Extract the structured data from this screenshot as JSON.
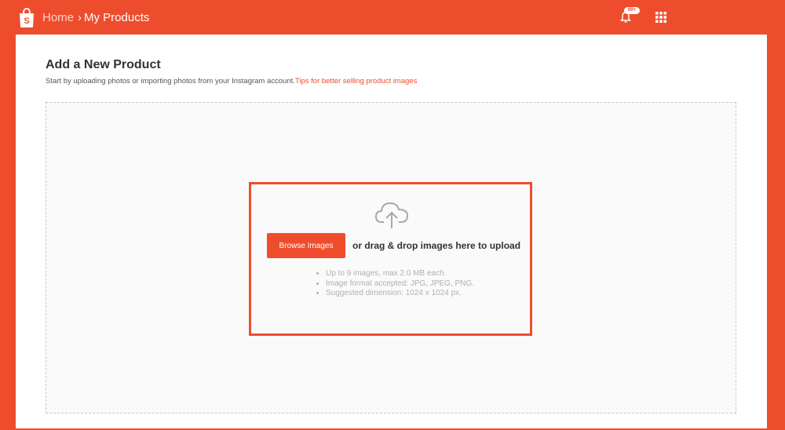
{
  "header": {
    "breadcrumb": {
      "home": "Home",
      "separator": "›",
      "current": "My Products"
    },
    "notification_badge": "99+",
    "icons": {
      "logo": "shopee-bag-icon",
      "bell": "bell-icon",
      "apps": "grid-apps-icon"
    }
  },
  "page": {
    "title": "Add a New Product",
    "subtitle": "Start by uploading photos or importing photos from your Instagram account.",
    "tips_link": "Tips for better selling product images"
  },
  "upload": {
    "icon": "cloud-upload-icon",
    "browse_label": "Browse Images",
    "drag_text": "or drag & drop images here to upload",
    "rules": [
      "Up to 9 images, max 2.0 MB each.",
      "Image format accepted: JPG, JPEG, PNG.",
      "Suggested dimension: 1024 x 1024 px."
    ]
  },
  "colors": {
    "brand": "#ee4d2d",
    "highlight_border": "#ee4d2d",
    "muted_text": "#b0b0b0"
  }
}
